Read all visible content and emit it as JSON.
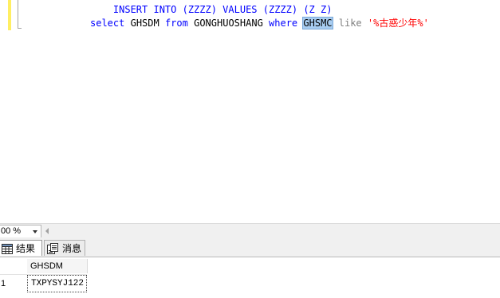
{
  "editor": {
    "top_line": "INSERT INTO (ZZZZ) VALUES (ZZZZ) (Z Z)",
    "query": {
      "kw_select": "select",
      "col": "GHSDM",
      "kw_from": "from",
      "table": "GONGHUOSHANG",
      "kw_where": "where",
      "selected_col": "GHSMC",
      "kw_like": "like",
      "pattern": "'%古惑少年%'"
    }
  },
  "statusbar": {
    "zoom": "00 %"
  },
  "tabs": [
    {
      "label": "结果",
      "icon": "grid-icon"
    },
    {
      "label": "消息",
      "icon": "message-icon"
    }
  ],
  "results": {
    "columns": [
      "GHSDM"
    ],
    "rows": [
      {
        "row_number": "1",
        "cells": [
          "TXPYSYJ122"
        ]
      }
    ]
  },
  "colors": {
    "keyword": "#0000ff",
    "string": "#ff0000",
    "ghost": "#808080",
    "selection": "#a8cdf1",
    "change_marker": "#ffee62"
  }
}
